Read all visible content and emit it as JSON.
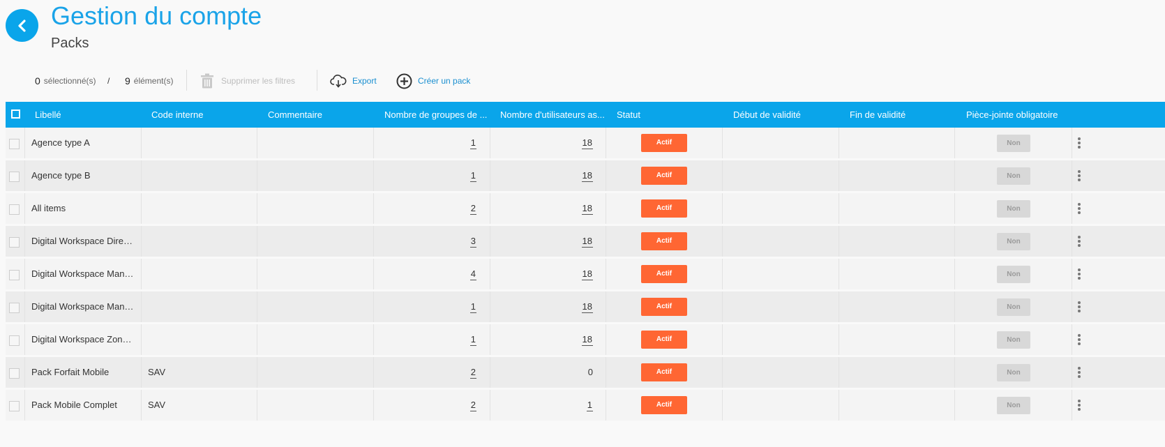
{
  "header": {
    "title": "Gestion du compte",
    "subtitle": "Packs"
  },
  "toolbar": {
    "selected_count": "0",
    "selected_label": "sélectionné(s)",
    "separator": "/",
    "total_count": "9",
    "total_label": "élément(s)",
    "clear_filters_label": "Supprimer les filtres",
    "export_label": "Export",
    "create_label": "Créer un pack"
  },
  "columns": [
    "Libellé",
    "Code interne",
    "Commentaire",
    "Nombre de groupes de ...",
    "Nombre d'utilisateurs as...",
    "Statut",
    "Début de validité",
    "Fin de validité",
    "Pièce-jointe obligatoire"
  ],
  "rows": [
    {
      "label": "Agence type A",
      "code": "",
      "comment": "",
      "groups": "1",
      "users": "18",
      "users_link": true,
      "status": "Actif",
      "start": "",
      "end": "",
      "attachment": "Non"
    },
    {
      "label": "Agence type B",
      "code": "",
      "comment": "",
      "groups": "1",
      "users": "18",
      "users_link": true,
      "status": "Actif",
      "start": "",
      "end": "",
      "attachment": "Non"
    },
    {
      "label": "All items",
      "code": "",
      "comment": "",
      "groups": "2",
      "users": "18",
      "users_link": true,
      "status": "Actif",
      "start": "",
      "end": "",
      "attachment": "Non"
    },
    {
      "label": "Digital Workspace Director",
      "code": "",
      "comment": "",
      "groups": "3",
      "users": "18",
      "users_link": true,
      "status": "Actif",
      "start": "",
      "end": "",
      "attachment": "Non"
    },
    {
      "label": "Digital Workspace Manager",
      "code": "",
      "comment": "",
      "groups": "4",
      "users": "18",
      "users_link": true,
      "status": "Actif",
      "start": "",
      "end": "",
      "attachment": "Non"
    },
    {
      "label": "Digital Workspace Manag...",
      "code": "",
      "comment": "",
      "groups": "1",
      "users": "18",
      "users_link": true,
      "status": "Actif",
      "start": "",
      "end": "",
      "attachment": "Non"
    },
    {
      "label": "Digital Workspace Zone A...",
      "code": "",
      "comment": "",
      "groups": "1",
      "users": "18",
      "users_link": true,
      "status": "Actif",
      "start": "",
      "end": "",
      "attachment": "Non"
    },
    {
      "label": "Pack Forfait Mobile",
      "code": "SAV",
      "comment": "",
      "groups": "2",
      "users": "0",
      "users_link": false,
      "status": "Actif",
      "start": "",
      "end": "",
      "attachment": "Non"
    },
    {
      "label": "Pack Mobile Complet",
      "code": "SAV",
      "comment": "",
      "groups": "2",
      "users": "1",
      "users_link": true,
      "status": "Actif",
      "start": "",
      "end": "",
      "attachment": "Non"
    }
  ],
  "icons": {
    "back": "chevron-left-icon",
    "trash": "trash-icon",
    "export": "cloud-download-icon",
    "create": "plus-circle-icon",
    "row_menu": "kebab-menu-icon"
  },
  "colors": {
    "accent": "#0aa5ea",
    "status_active": "#ff6633",
    "badge_non": "#d8d8d8"
  }
}
